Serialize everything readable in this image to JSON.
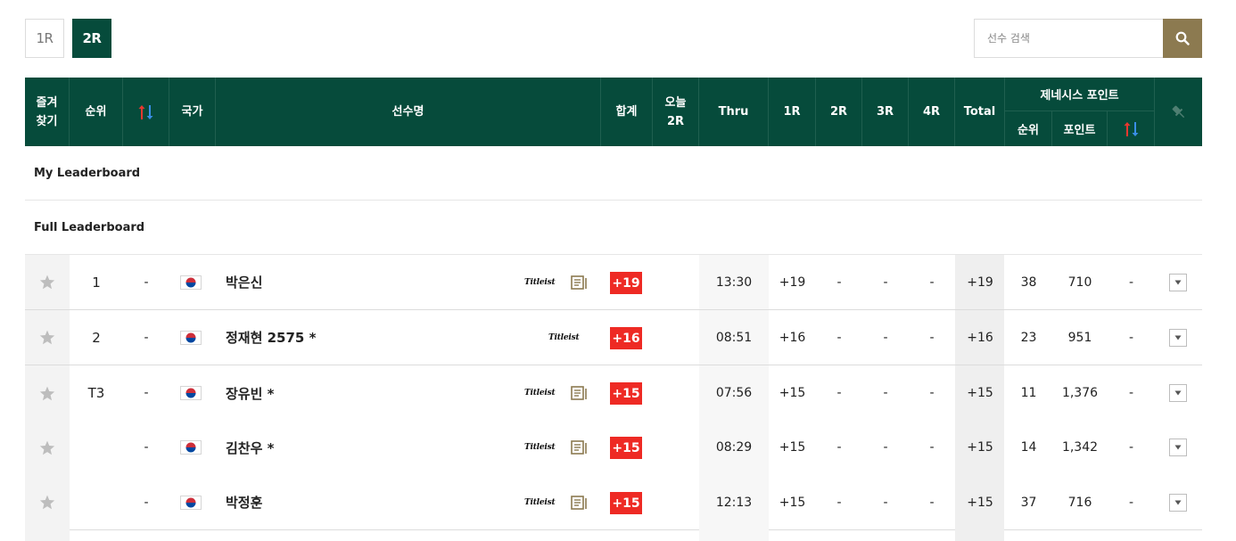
{
  "rounds": [
    {
      "label": "1R",
      "active": false
    },
    {
      "label": "2R",
      "active": true
    }
  ],
  "search": {
    "placeholder": "선수 검색"
  },
  "header": {
    "favorite": "즐겨\n찾기",
    "rank": "순위",
    "country": "국가",
    "player": "선수명",
    "sum": "합계",
    "today": "오늘\n2R",
    "thru": "Thru",
    "r1": "1R",
    "r2": "2R",
    "r3": "3R",
    "r4": "4R",
    "total": "Total",
    "genesis": "제네시스 포인트",
    "genesis_rank": "순위",
    "genesis_points": "포인트"
  },
  "sections": {
    "my": "My Leaderboard",
    "full": "Full Leaderboard"
  },
  "colors": {
    "header_bg": "#064b3b",
    "score_badge": "#ee2a24",
    "search_btn": "#8c7a50",
    "arrow_up": "#e8382f",
    "arrow_down": "#3a8ee6"
  },
  "players": [
    {
      "rank": "1",
      "move": "-",
      "country": "KOR",
      "name": "박은신",
      "sponsor": "Titleist",
      "has_news": true,
      "sum": "+19",
      "today": "",
      "thru": "13:30",
      "r1": "+19",
      "r2": "-",
      "r3": "-",
      "r4": "-",
      "total": "+19",
      "g_rank": "38",
      "g_points": "710",
      "g_move": "-"
    },
    {
      "rank": "2",
      "move": "-",
      "country": "KOR",
      "name": "정재현 2575 *",
      "sponsor": "Titleist",
      "has_news": false,
      "sum": "+16",
      "today": "",
      "thru": "08:51",
      "r1": "+16",
      "r2": "-",
      "r3": "-",
      "r4": "-",
      "total": "+16",
      "g_rank": "23",
      "g_points": "951",
      "g_move": "-"
    },
    {
      "rank": "T3",
      "move": "-",
      "country": "KOR",
      "name": "장유빈 *",
      "sponsor": "Titleist",
      "has_news": true,
      "sum": "+15",
      "today": "",
      "thru": "07:56",
      "r1": "+15",
      "r2": "-",
      "r3": "-",
      "r4": "-",
      "total": "+15",
      "g_rank": "11",
      "g_points": "1,376",
      "g_move": "-"
    },
    {
      "rank": "",
      "move": "-",
      "country": "KOR",
      "name": "김찬우 *",
      "sponsor": "Titleist",
      "has_news": true,
      "sum": "+15",
      "today": "",
      "thru": "08:29",
      "r1": "+15",
      "r2": "-",
      "r3": "-",
      "r4": "-",
      "total": "+15",
      "g_rank": "14",
      "g_points": "1,342",
      "g_move": "-"
    },
    {
      "rank": "",
      "move": "-",
      "country": "KOR",
      "name": "박정훈",
      "sponsor": "Titleist",
      "has_news": true,
      "sum": "+15",
      "today": "",
      "thru": "12:13",
      "r1": "+15",
      "r2": "-",
      "r3": "-",
      "r4": "-",
      "total": "+15",
      "g_rank": "37",
      "g_points": "716",
      "g_move": "-"
    }
  ]
}
